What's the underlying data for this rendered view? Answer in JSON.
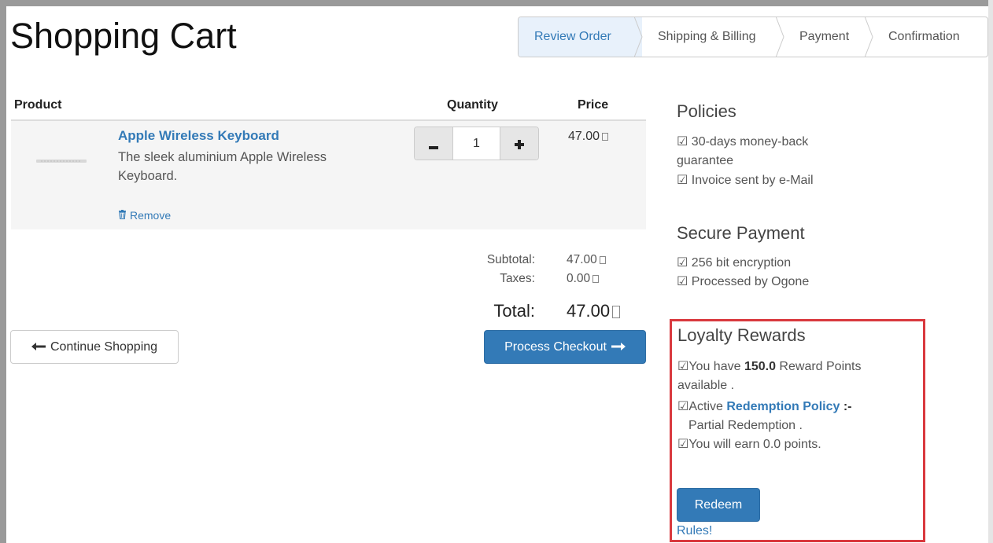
{
  "page": {
    "title": "Shopping Cart"
  },
  "wizard": {
    "steps": [
      {
        "label": "Review Order",
        "active": true
      },
      {
        "label": "Shipping & Billing",
        "active": false
      },
      {
        "label": "Payment",
        "active": false
      },
      {
        "label": "Confirmation",
        "active": false
      }
    ]
  },
  "cart": {
    "headers": {
      "product": "Product",
      "quantity": "Quantity",
      "price": "Price"
    },
    "items": [
      {
        "name": "Apple Wireless Keyboard",
        "description": "The sleek aluminium Apple Wireless Keyboard.",
        "quantity": "1",
        "price": "47.00",
        "remove_label": "Remove"
      }
    ],
    "summary": {
      "subtotal_label": "Subtotal:",
      "subtotal_value": "47.00",
      "taxes_label": "Taxes:",
      "taxes_value": "0.00",
      "total_label": "Total:",
      "total_value": "47.00"
    },
    "actions": {
      "continue_label": "Continue Shopping",
      "checkout_label": "Process Checkout"
    }
  },
  "sidebar": {
    "policies": {
      "title": "Policies",
      "line1": "☑ 30-days money-back",
      "line1b": "guarantee",
      "line2": "☑ Invoice sent by e-Mail"
    },
    "secure_payment": {
      "title": "Secure Payment",
      "line1": "☑ 256 bit encryption",
      "line2": "☑ Processed by Ogone"
    },
    "loyalty": {
      "title": "Loyalty Rewards",
      "points_prefix": "☑You have ",
      "points_value": "150.0",
      "points_suffix": " Reward Points",
      "points_line2": "available .",
      "policy_prefix": "☑Active ",
      "policy_link": "Redemption Policy",
      "policy_suffix": " :-",
      "policy_line2": "Partial Redemption .",
      "earn_line": "☑You will earn 0.0 points.",
      "redeem_label": "Redeem",
      "rules_label": "Rules!"
    }
  },
  "colors": {
    "primary": "#337ab7",
    "highlight_border": "#d9393e",
    "active_step_bg": "#e8f1fb"
  }
}
